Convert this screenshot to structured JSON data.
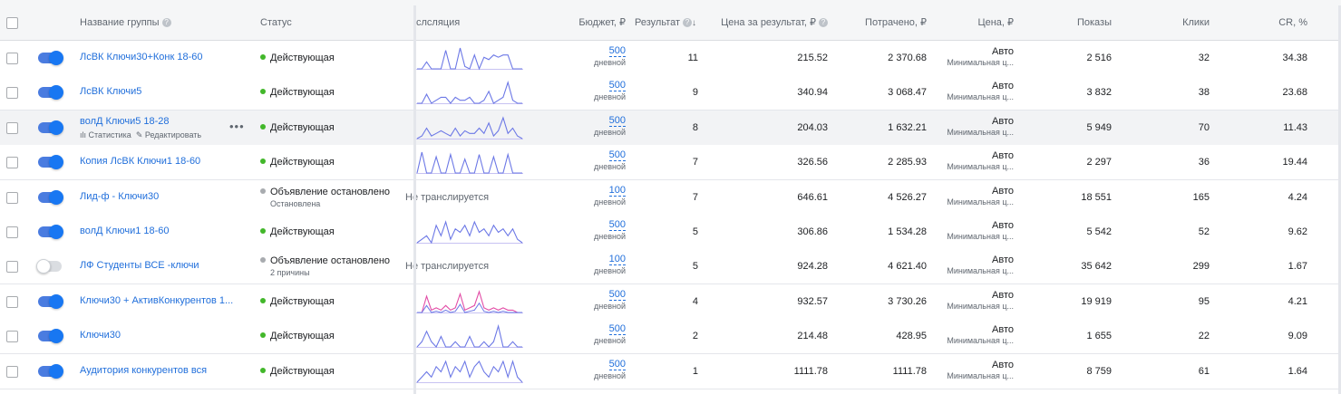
{
  "header": {
    "group_name": "Название группы",
    "status": "Статус",
    "delivery": "слсляция",
    "budget": "Бюджет, ₽",
    "result": "Результат",
    "cost_per_result": "Цена за результат, ₽",
    "spent": "Потрачено, ₽",
    "price": "Цена, ₽",
    "impressions": "Показы",
    "clicks": "Клики",
    "cr": "CR, %"
  },
  "row_actions": {
    "stats": "Статистика",
    "edit": "Редактировать"
  },
  "colors": {
    "accent": "#1877f2",
    "link": "#216fdb",
    "active": "#42b72a",
    "stopped": "#a8abaf",
    "spark_blue": "#6c78e6",
    "spark_pink": "#e24ca6"
  },
  "rows": [
    {
      "name": "ЛсВК Ключи30+Конк 18-60",
      "on": true,
      "status": "Действующая",
      "status_sub": "",
      "active": true,
      "delivery_text": "",
      "budget": "500",
      "budget_period": "дневной",
      "result": "11",
      "cpr": "215.52",
      "spent": "2 370.68",
      "price": "Авто",
      "bid": "Минимальная ц...",
      "impr": "2 516",
      "clicks": "32",
      "cr": "34.38",
      "spark": [
        0,
        0,
        3,
        0,
        0,
        0,
        8,
        0,
        0,
        9,
        1,
        0,
        6,
        0,
        5,
        4,
        6,
        5,
        6,
        6,
        0,
        0,
        0
      ],
      "pink": false
    },
    {
      "name": "ЛсВК Ключи5",
      "on": true,
      "status": "Действующая",
      "status_sub": "",
      "active": true,
      "delivery_text": "",
      "budget": "500",
      "budget_period": "дневной",
      "result": "9",
      "cpr": "340.94",
      "spent": "3 068.47",
      "price": "Авто",
      "bid": "Минимальная ц...",
      "impr": "3 832",
      "clicks": "38",
      "cr": "23.68",
      "spark": [
        0,
        0,
        3,
        0,
        1,
        2,
        2,
        0,
        2,
        1,
        1,
        2,
        0,
        0,
        1,
        4,
        0,
        1,
        2,
        7,
        1,
        0,
        0
      ],
      "pink": false
    },
    {
      "name": "волД Ключи5 18-28",
      "on": true,
      "status": "Действующая",
      "status_sub": "",
      "active": true,
      "delivery_text": "",
      "budget": "500",
      "budget_period": "дневной",
      "result": "8",
      "cpr": "204.03",
      "spent": "1 632.21",
      "price": "Авто",
      "bid": "Минимальная ц...",
      "impr": "5 949",
      "clicks": "70",
      "cr": "11.43",
      "spark": [
        0,
        1,
        4,
        1,
        2,
        3,
        2,
        1,
        4,
        1,
        3,
        2,
        2,
        4,
        2,
        6,
        1,
        3,
        8,
        2,
        4,
        1,
        0
      ],
      "pink": false,
      "hover": true
    },
    {
      "name": "Копия ЛсВК Ключи1 18-60",
      "on": true,
      "status": "Действующая",
      "status_sub": "",
      "active": true,
      "delivery_text": "",
      "budget": "500",
      "budget_period": "дневной",
      "result": "7",
      "cpr": "326.56",
      "spent": "2 285.93",
      "price": "Авто",
      "bid": "Минимальная ц...",
      "impr": "2 297",
      "clicks": "36",
      "cr": "19.44",
      "spark": [
        0,
        9,
        0,
        0,
        7,
        0,
        0,
        8,
        0,
        0,
        6,
        0,
        0,
        8,
        0,
        0,
        7,
        0,
        0,
        8,
        0,
        0,
        0
      ],
      "pink": false
    },
    {
      "name": "Лид-ф - Ключи30",
      "on": true,
      "status": "Объявление остановлено",
      "status_sub": "Остановлена",
      "active": false,
      "delivery_text": "Не транслируется",
      "budget": "100",
      "budget_period": "дневной",
      "result": "7",
      "cpr": "646.61",
      "spent": "4 526.27",
      "price": "Авто",
      "bid": "Минимальная ц...",
      "impr": "18 551",
      "clicks": "165",
      "cr": "4.24",
      "spark": [],
      "pink": false
    },
    {
      "name": "волД Ключи1 18-60",
      "on": true,
      "status": "Действующая",
      "status_sub": "",
      "active": true,
      "delivery_text": "",
      "budget": "500",
      "budget_period": "дневной",
      "result": "5",
      "cpr": "306.86",
      "spent": "1 534.28",
      "price": "Авто",
      "bid": "Минимальная ц...",
      "impr": "5 542",
      "clicks": "52",
      "cr": "9.62",
      "spark": [
        0,
        1,
        2,
        0,
        5,
        2,
        6,
        1,
        4,
        3,
        5,
        2,
        6,
        3,
        4,
        2,
        5,
        3,
        4,
        2,
        4,
        1,
        0
      ],
      "pink": false
    },
    {
      "name": "ЛФ Студенты ВСЕ -ключи",
      "on": false,
      "status": "Объявление остановлено",
      "status_sub": "2 причины",
      "active": false,
      "delivery_text": "Не транслируется",
      "budget": "100",
      "budget_period": "дневной",
      "result": "5",
      "cpr": "924.28",
      "spent": "4 621.40",
      "price": "Авто",
      "bid": "Минимальная ц...",
      "impr": "35 642",
      "clicks": "299",
      "cr": "1.67",
      "spark": [],
      "pink": false
    },
    {
      "name": "Ключи30 + АктивКонкурентов 1...",
      "on": true,
      "status": "Действующая",
      "status_sub": "",
      "active": true,
      "delivery_text": "",
      "budget": "500",
      "budget_period": "дневной",
      "result": "4",
      "cpr": "932.57",
      "spent": "3 730.26",
      "price": "Авто",
      "bid": "Минимальная ц...",
      "impr": "19 919",
      "clicks": "95",
      "cr": "4.21",
      "spark": [
        0,
        0,
        7,
        1,
        2,
        1,
        3,
        1,
        2,
        8,
        1,
        2,
        3,
        9,
        2,
        1,
        2,
        1,
        2,
        1,
        1,
        0,
        0
      ],
      "pink": true
    },
    {
      "name": "Ключи30",
      "on": true,
      "status": "Действующая",
      "status_sub": "",
      "active": true,
      "delivery_text": "",
      "budget": "500",
      "budget_period": "дневной",
      "result": "2",
      "cpr": "214.48",
      "spent": "428.95",
      "price": "Авто",
      "bid": "Минимальная ц...",
      "impr": "1 655",
      "clicks": "22",
      "cr": "9.09",
      "spark": [
        0,
        1,
        3,
        1,
        0,
        2,
        0,
        0,
        1,
        0,
        0,
        2,
        0,
        0,
        1,
        0,
        1,
        4,
        0,
        0,
        1,
        0,
        0
      ],
      "pink": false
    },
    {
      "name": "Аудитория конкурентов вся",
      "on": true,
      "status": "Действующая",
      "status_sub": "",
      "active": true,
      "delivery_text": "",
      "budget": "500",
      "budget_period": "дневной",
      "result": "1",
      "cpr": "1111.78",
      "spent": "1111.78",
      "price": "Авто",
      "bid": "Минимальная ц...",
      "impr": "8 759",
      "clicks": "61",
      "cr": "1.64",
      "spark": [
        0,
        1,
        2,
        1,
        3,
        2,
        4,
        1,
        3,
        2,
        4,
        1,
        3,
        4,
        2,
        1,
        3,
        2,
        4,
        1,
        4,
        1,
        0
      ],
      "pink": false
    }
  ]
}
